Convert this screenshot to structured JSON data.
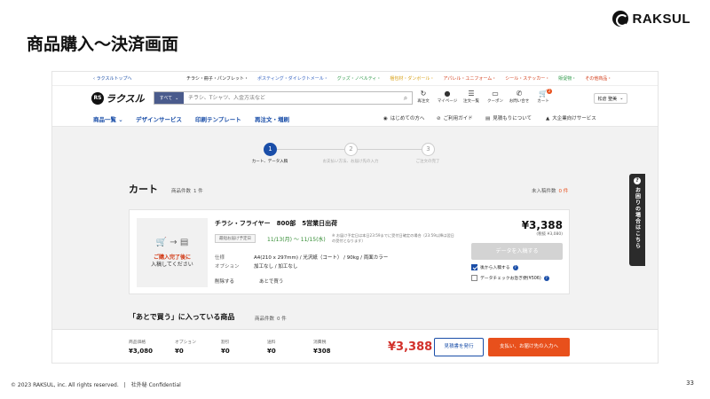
{
  "slide": {
    "title": "商品購入〜決済画面",
    "brand": "RAKSUL",
    "footer_copyright": "© 2023 RAKSUL, inc. All rights reserved.",
    "footer_conf": "社外秘 Confidential",
    "page_number": "33"
  },
  "top_strip": {
    "back_link": "‹ ラクスルトップへ",
    "categories": [
      {
        "label": "チラシ・冊子・パンフレット・",
        "color": "#222222"
      },
      {
        "label": "ポスティング・ダイレクトメール・",
        "color": "#2f5fc0"
      },
      {
        "label": "グッズ・ノベルティ・",
        "color": "#2f9a4a"
      },
      {
        "label": "梱包材・ダンボール・",
        "color": "#d8a21a"
      },
      {
        "label": "アパレル・ユニフォーム・",
        "color": "#d23a16"
      },
      {
        "label": "シール・ステッカー・",
        "color": "#d23a16"
      },
      {
        "label": "販促物・",
        "color": "#2f9a4a"
      },
      {
        "label": "その他商品・",
        "color": "#d23a16"
      }
    ]
  },
  "header": {
    "logo_mark": "RS",
    "logo_text": "ラクスル",
    "search_scope": "すべて",
    "search_placeholder": "チラシ、Tシャツ、入金方法など",
    "icons": [
      {
        "label": "再注文",
        "glyph": "↻",
        "name": "reorder-icon"
      },
      {
        "label": "マイページ",
        "glyph": "●",
        "name": "user-icon"
      },
      {
        "label": "注文一覧",
        "glyph": "☰",
        "name": "order-list-icon"
      },
      {
        "label": "クーポン",
        "glyph": "▭",
        "name": "coupon-icon"
      },
      {
        "label": "お問い合せ",
        "glyph": "✆",
        "name": "phone-icon"
      },
      {
        "label": "カート",
        "glyph": "🛒",
        "name": "cart-icon"
      }
    ],
    "cart_badge": "2",
    "user_name": "松倉 聖美"
  },
  "nav": {
    "items": [
      "商品一覧 ⌄",
      "デザインサービス",
      "印刷テンプレート",
      "再注文・増刷"
    ],
    "utils": [
      {
        "label": "はじめての方へ",
        "glyph": "◉",
        "name": "shield-icon"
      },
      {
        "label": "ご利用ガイド",
        "glyph": "⊘",
        "name": "guide-icon"
      },
      {
        "label": "見積もりについて",
        "glyph": "▤",
        "name": "estimate-icon"
      },
      {
        "label": "大企業向けサービス",
        "glyph": "▲",
        "name": "enterprise-icon"
      }
    ]
  },
  "steps": [
    {
      "num": "1",
      "label": "カート、データ入稿",
      "active": true
    },
    {
      "num": "2",
      "label": "お支払い方法、お届け先の入力",
      "active": false
    },
    {
      "num": "3",
      "label": "ご注文の完了",
      "active": false
    }
  ],
  "cart": {
    "title": "カート",
    "count_label": "商品件数",
    "count_value": "1 件",
    "later_top_label": "未入稿件数",
    "later_top_value": "0 件"
  },
  "item": {
    "image_icons": "🛒 → ▤",
    "image_msg_red": "ご購入完了後に",
    "image_msg": "入稿してください",
    "name": "チラシ・フライヤー　800部　5営業日出荷",
    "delivery_tag": "最短お届け予定日",
    "delivery_date": "11/13(月) 〜 11/15(水)",
    "delivery_note": "※ お届け予定日は本日23:59までに受付日確定の場合（23:59以降は翌日の受付となります）",
    "spec_label": "仕様",
    "spec_value": "A4(210 x 297mm) / 光沢紙（コート） / 90kg / 両面カラー",
    "option_label": "オプション",
    "option_value": "加工なし / 加工なし",
    "delete_link": "削除する",
    "later_link": "あとで買う",
    "price": "¥3,388",
    "price_tax": "(税抜 ¥3,080)",
    "upload_button": "データを入稿する",
    "opt_later_upload": "後から入稿する",
    "opt_data_check": "データチェックお急ぎ便(¥506)"
  },
  "later": {
    "title": "「あとで買う」に入っている商品",
    "count_label": "商品件数",
    "count_value": "0 件"
  },
  "summary": {
    "items": [
      {
        "label": "商品価格",
        "value": "¥3,080"
      },
      {
        "label": "オプション",
        "value": "¥0"
      },
      {
        "label": "割引",
        "value": "¥0"
      },
      {
        "label": "送料",
        "value": "¥0"
      },
      {
        "label": "消費税",
        "value": "¥308"
      }
    ],
    "total": "¥3,388",
    "quote_button": "見積書を発行",
    "pay_button": "支払い、お届け先の入力へ"
  },
  "help_tab": {
    "icon": "?",
    "label": "お困りの場合はこちら"
  }
}
